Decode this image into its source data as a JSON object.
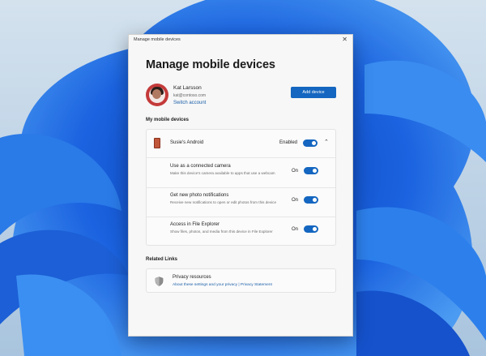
{
  "window": {
    "title": "Manage mobile devices",
    "close_glyph": "✕"
  },
  "page": {
    "heading": "Manage mobile devices"
  },
  "account": {
    "name": "Kat Larsson",
    "email": "kat@contoso.com",
    "switch_label": "Switch account"
  },
  "actions": {
    "add_device_label": "Add device"
  },
  "devices_section": {
    "label": "My mobile devices",
    "device": {
      "name": "Susie's Android",
      "status_label": "Enabled",
      "enabled": true,
      "expanded_glyph": "⌃",
      "icon": "phone-icon"
    },
    "settings": [
      {
        "title": "Use as a connected camera",
        "description": "Make this device's camera available to apps that use a webcam",
        "state_label": "On",
        "on": true
      },
      {
        "title": "Get new photo notifications",
        "description": "Receive new notifications to open or edit photos from this device",
        "state_label": "On",
        "on": true
      },
      {
        "title": "Access in File Explorer",
        "description": "Show files, photos, and media from this device in File Explorer",
        "state_label": "On",
        "on": true
      }
    ]
  },
  "related": {
    "label": "Related Links",
    "privacy": {
      "title": "Privacy resources",
      "links": "About these settings and your privacy | Privacy Statement",
      "icon": "shield-icon"
    }
  },
  "colors": {
    "accent": "#1466c0",
    "link": "#1a5ea8",
    "dialog_bg": "#f7f7f7"
  }
}
